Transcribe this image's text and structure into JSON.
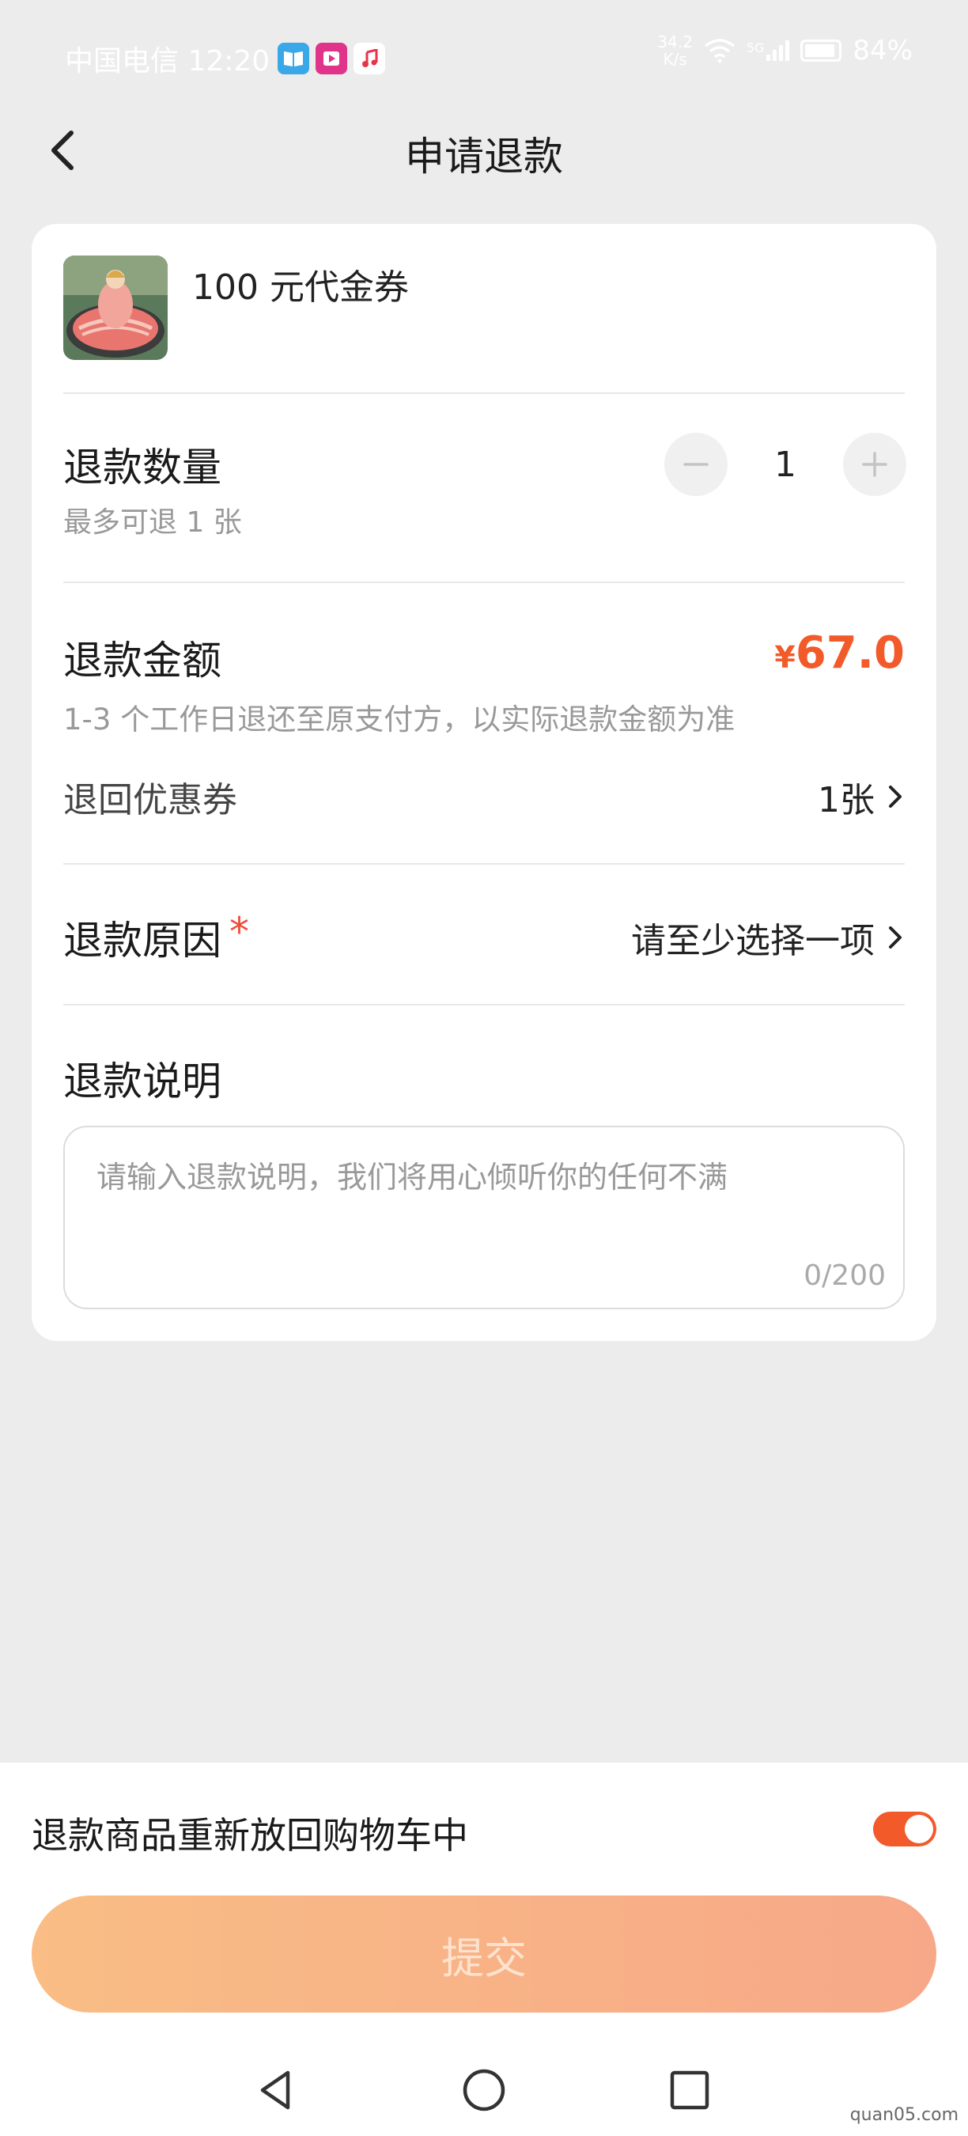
{
  "status_bar": {
    "carrier_time": "中国电信 12:20",
    "net_speed_value": "34.2",
    "net_speed_unit": "K/s",
    "network": "5G",
    "battery": "84%"
  },
  "header": {
    "title": "申请退款"
  },
  "product": {
    "name": "100 元代金券"
  },
  "quantity": {
    "label": "退款数量",
    "hint": "最多可退 1 张",
    "value": "1",
    "minus": "−",
    "plus": "+"
  },
  "amount": {
    "label": "退款金额",
    "currency": "¥",
    "value": "67.0",
    "note": "1-3 个工作日退还至原支付方，以实际退款金额为准"
  },
  "coupon": {
    "label": "退回优惠券",
    "value": "1张"
  },
  "reason": {
    "label": "退款原因",
    "required_mark": "*",
    "value": "请至少选择一项"
  },
  "description": {
    "label": "退款说明",
    "placeholder": "请输入退款说明，我们将用心倾听你的任何不满",
    "counter": "0/200"
  },
  "cart_option": {
    "label": "退款商品重新放回购物车中",
    "enabled": true
  },
  "submit": {
    "label": "提交"
  },
  "watermark": "quan05.com",
  "colors": {
    "accent": "#f25a2a",
    "page_bg": "#ececec",
    "submit_gradient_start": "#f9bd85",
    "submit_gradient_end": "#f7a888"
  }
}
